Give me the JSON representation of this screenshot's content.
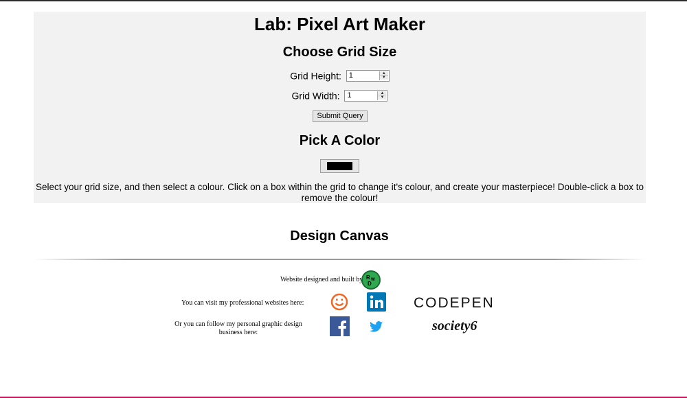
{
  "header": {
    "title": "Lab: Pixel Art Maker",
    "grid_section_title": "Choose Grid Size",
    "color_section_title": "Pick A Color"
  },
  "grid_form": {
    "height_label": "Grid Height:",
    "height_value": "1",
    "width_label": "Grid Width:",
    "width_value": "1",
    "submit_label": "Submit Query"
  },
  "color_picker": {
    "selected_color": "#000000"
  },
  "instructions": "Select your grid size, and then select a colour. Click on a box within the grid to change it's colour, and create your masterpiece! Double-click a box to remove the colour!",
  "canvas": {
    "title": "Design Canvas"
  },
  "footer": {
    "credit_text": "Website designed and built by",
    "visit_text": "You can visit my professional websites here:",
    "follow_text": "Or you can follow my personal graphic design business here:",
    "codepen_wordmark": "CODEPEN",
    "society6_wordmark": "society6",
    "rwd_logo_text": "RWD"
  },
  "colors": {
    "panel_bg": "#f2f2f2",
    "linkedin": "#0077b5",
    "facebook": "#3b5998",
    "twitter": "#1da1f2",
    "smile": "#f26522",
    "rwd_logo": "#2fa84f"
  }
}
